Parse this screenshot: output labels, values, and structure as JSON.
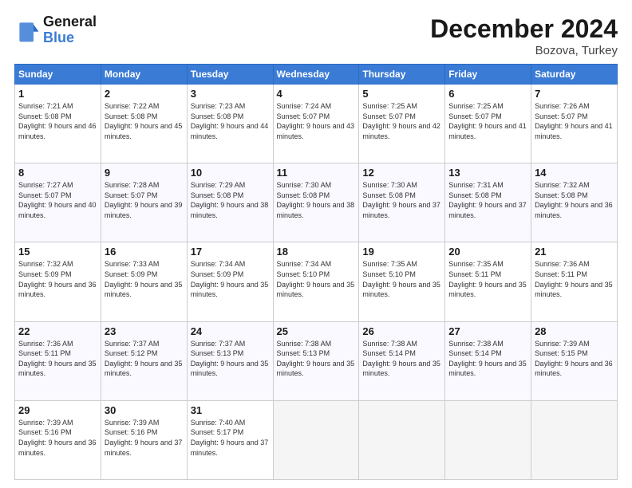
{
  "header": {
    "logo_line1": "General",
    "logo_line2": "Blue",
    "month_year": "December 2024",
    "location": "Bozova, Turkey"
  },
  "weekdays": [
    "Sunday",
    "Monday",
    "Tuesday",
    "Wednesday",
    "Thursday",
    "Friday",
    "Saturday"
  ],
  "weeks": [
    [
      {
        "day": 1,
        "sunrise": "7:21 AM",
        "sunset": "5:08 PM",
        "daylight": "9 hours and 46 minutes."
      },
      {
        "day": 2,
        "sunrise": "7:22 AM",
        "sunset": "5:08 PM",
        "daylight": "9 hours and 45 minutes."
      },
      {
        "day": 3,
        "sunrise": "7:23 AM",
        "sunset": "5:08 PM",
        "daylight": "9 hours and 44 minutes."
      },
      {
        "day": 4,
        "sunrise": "7:24 AM",
        "sunset": "5:07 PM",
        "daylight": "9 hours and 43 minutes."
      },
      {
        "day": 5,
        "sunrise": "7:25 AM",
        "sunset": "5:07 PM",
        "daylight": "9 hours and 42 minutes."
      },
      {
        "day": 6,
        "sunrise": "7:25 AM",
        "sunset": "5:07 PM",
        "daylight": "9 hours and 41 minutes."
      },
      {
        "day": 7,
        "sunrise": "7:26 AM",
        "sunset": "5:07 PM",
        "daylight": "9 hours and 41 minutes."
      }
    ],
    [
      {
        "day": 8,
        "sunrise": "7:27 AM",
        "sunset": "5:07 PM",
        "daylight": "9 hours and 40 minutes."
      },
      {
        "day": 9,
        "sunrise": "7:28 AM",
        "sunset": "5:07 PM",
        "daylight": "9 hours and 39 minutes."
      },
      {
        "day": 10,
        "sunrise": "7:29 AM",
        "sunset": "5:08 PM",
        "daylight": "9 hours and 38 minutes."
      },
      {
        "day": 11,
        "sunrise": "7:30 AM",
        "sunset": "5:08 PM",
        "daylight": "9 hours and 38 minutes."
      },
      {
        "day": 12,
        "sunrise": "7:30 AM",
        "sunset": "5:08 PM",
        "daylight": "9 hours and 37 minutes."
      },
      {
        "day": 13,
        "sunrise": "7:31 AM",
        "sunset": "5:08 PM",
        "daylight": "9 hours and 37 minutes."
      },
      {
        "day": 14,
        "sunrise": "7:32 AM",
        "sunset": "5:08 PM",
        "daylight": "9 hours and 36 minutes."
      }
    ],
    [
      {
        "day": 15,
        "sunrise": "7:32 AM",
        "sunset": "5:09 PM",
        "daylight": "9 hours and 36 minutes."
      },
      {
        "day": 16,
        "sunrise": "7:33 AM",
        "sunset": "5:09 PM",
        "daylight": "9 hours and 35 minutes."
      },
      {
        "day": 17,
        "sunrise": "7:34 AM",
        "sunset": "5:09 PM",
        "daylight": "9 hours and 35 minutes."
      },
      {
        "day": 18,
        "sunrise": "7:34 AM",
        "sunset": "5:10 PM",
        "daylight": "9 hours and 35 minutes."
      },
      {
        "day": 19,
        "sunrise": "7:35 AM",
        "sunset": "5:10 PM",
        "daylight": "9 hours and 35 minutes."
      },
      {
        "day": 20,
        "sunrise": "7:35 AM",
        "sunset": "5:11 PM",
        "daylight": "9 hours and 35 minutes."
      },
      {
        "day": 21,
        "sunrise": "7:36 AM",
        "sunset": "5:11 PM",
        "daylight": "9 hours and 35 minutes."
      }
    ],
    [
      {
        "day": 22,
        "sunrise": "7:36 AM",
        "sunset": "5:11 PM",
        "daylight": "9 hours and 35 minutes."
      },
      {
        "day": 23,
        "sunrise": "7:37 AM",
        "sunset": "5:12 PM",
        "daylight": "9 hours and 35 minutes."
      },
      {
        "day": 24,
        "sunrise": "7:37 AM",
        "sunset": "5:13 PM",
        "daylight": "9 hours and 35 minutes."
      },
      {
        "day": 25,
        "sunrise": "7:38 AM",
        "sunset": "5:13 PM",
        "daylight": "9 hours and 35 minutes."
      },
      {
        "day": 26,
        "sunrise": "7:38 AM",
        "sunset": "5:14 PM",
        "daylight": "9 hours and 35 minutes."
      },
      {
        "day": 27,
        "sunrise": "7:38 AM",
        "sunset": "5:14 PM",
        "daylight": "9 hours and 35 minutes."
      },
      {
        "day": 28,
        "sunrise": "7:39 AM",
        "sunset": "5:15 PM",
        "daylight": "9 hours and 36 minutes."
      }
    ],
    [
      {
        "day": 29,
        "sunrise": "7:39 AM",
        "sunset": "5:16 PM",
        "daylight": "9 hours and 36 minutes."
      },
      {
        "day": 30,
        "sunrise": "7:39 AM",
        "sunset": "5:16 PM",
        "daylight": "9 hours and 37 minutes."
      },
      {
        "day": 31,
        "sunrise": "7:40 AM",
        "sunset": "5:17 PM",
        "daylight": "9 hours and 37 minutes."
      },
      null,
      null,
      null,
      null
    ]
  ]
}
